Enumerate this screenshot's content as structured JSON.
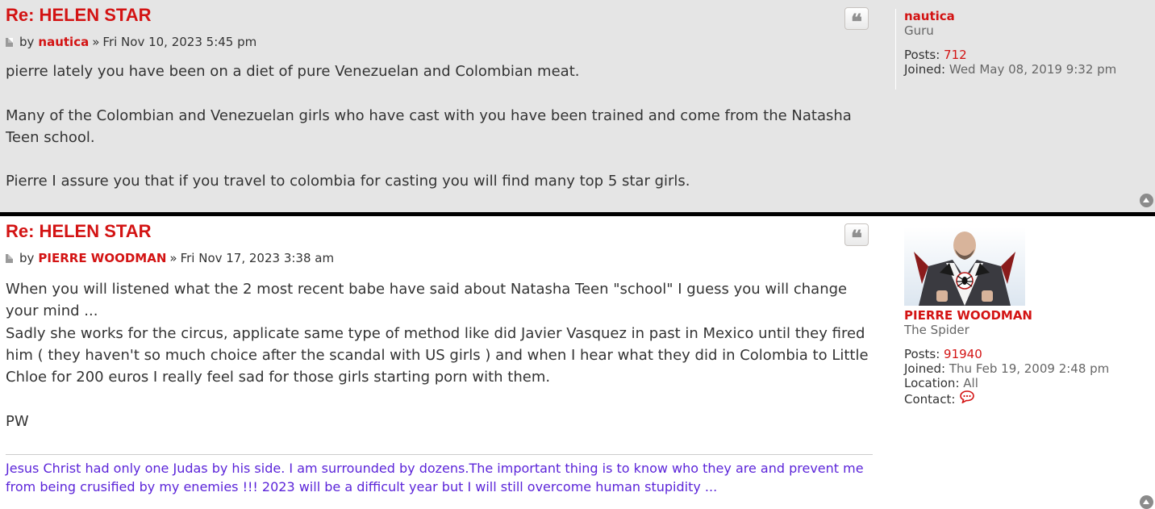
{
  "posts": [
    {
      "title": "Re: HELEN STAR",
      "by": "by",
      "author": "nautica",
      "separator": "»",
      "date": "Fri Nov 10, 2023 5:45 pm",
      "quote_icon": "❝",
      "content": [
        "pierre lately you have been on a diet of pure Venezuelan and Colombian meat.",
        "Many of the Colombian and Venezuelan girls who have cast with you have been trained and come from the Natasha Teen school.",
        "Pierre I assure you that if you travel to colombia for casting you will find many top 5 star girls."
      ],
      "profile": {
        "username": "nautica",
        "rank": "Guru",
        "posts_label": "Posts:",
        "posts_value": "712",
        "joined_label": "Joined:",
        "joined_value": "Wed May 08, 2019 9:32 pm"
      }
    },
    {
      "title": "Re: HELEN STAR",
      "by": "by",
      "author": "PIERRE WOODMAN",
      "separator": "»",
      "date": "Fri Nov 17, 2023 3:38 am",
      "quote_icon": "❝",
      "content": [
        "When you will listened what the 2 most recent babe have said about Natasha Teen \"school\" I guess you will change your mind ...",
        "Sadly she works for the circus, applicate same type of method like did Javier Vasquez in past in Mexico until they fired him ( they haven't so much choice after the scandal with US girls ) and when I hear what they did in Colombia to Little Chloe for 200 euros I really feel sad for those girls starting porn with them.",
        "PW"
      ],
      "signature": "Jesus Christ had only one Judas by his side. I am surrounded by dozens.The important thing is to know who they are and prevent me from being crusified by my enemies !!! 2023 will be a difficult year but I will still overcome human stupidity ...",
      "profile": {
        "username": "PIERRE WOODMAN",
        "rank": "The Spider",
        "posts_label": "Posts:",
        "posts_value": "91940",
        "joined_label": "Joined:",
        "joined_value": "Thu Feb 19, 2009 2:48 pm",
        "location_label": "Location:",
        "location_value": "All",
        "contact_label": "Contact:",
        "contact_icon": "speech-bubble-icon"
      }
    }
  ],
  "colors": {
    "accent": "#d31313",
    "signature": "#5b24d9",
    "post_bg_alt": "#e5e5e5"
  }
}
